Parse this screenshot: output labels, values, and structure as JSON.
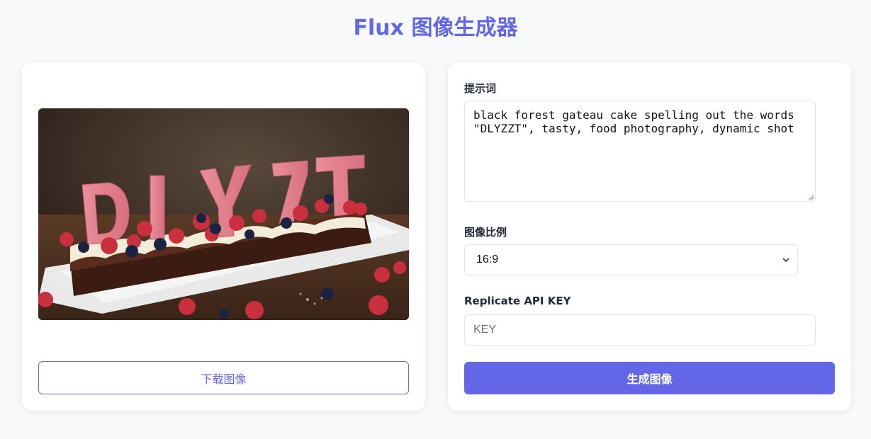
{
  "header": {
    "title": "Flux 图像生成器"
  },
  "preview": {
    "image_alt": "black forest gateau cake spelling out DLYZZT",
    "download_label": "下载图像"
  },
  "form": {
    "prompt_label": "提示词",
    "prompt_value": "black forest gateau cake spelling out the words \"DLYZZT\", tasty, food photography, dynamic shot",
    "ratio_label": "图像比例",
    "ratio_value": "16:9",
    "key_label": "Replicate API KEY",
    "key_placeholder": "KEY",
    "key_value": "",
    "generate_label": "生成图像"
  },
  "theme": {
    "accent": "#6366e6",
    "background": "#f8f9fa"
  }
}
